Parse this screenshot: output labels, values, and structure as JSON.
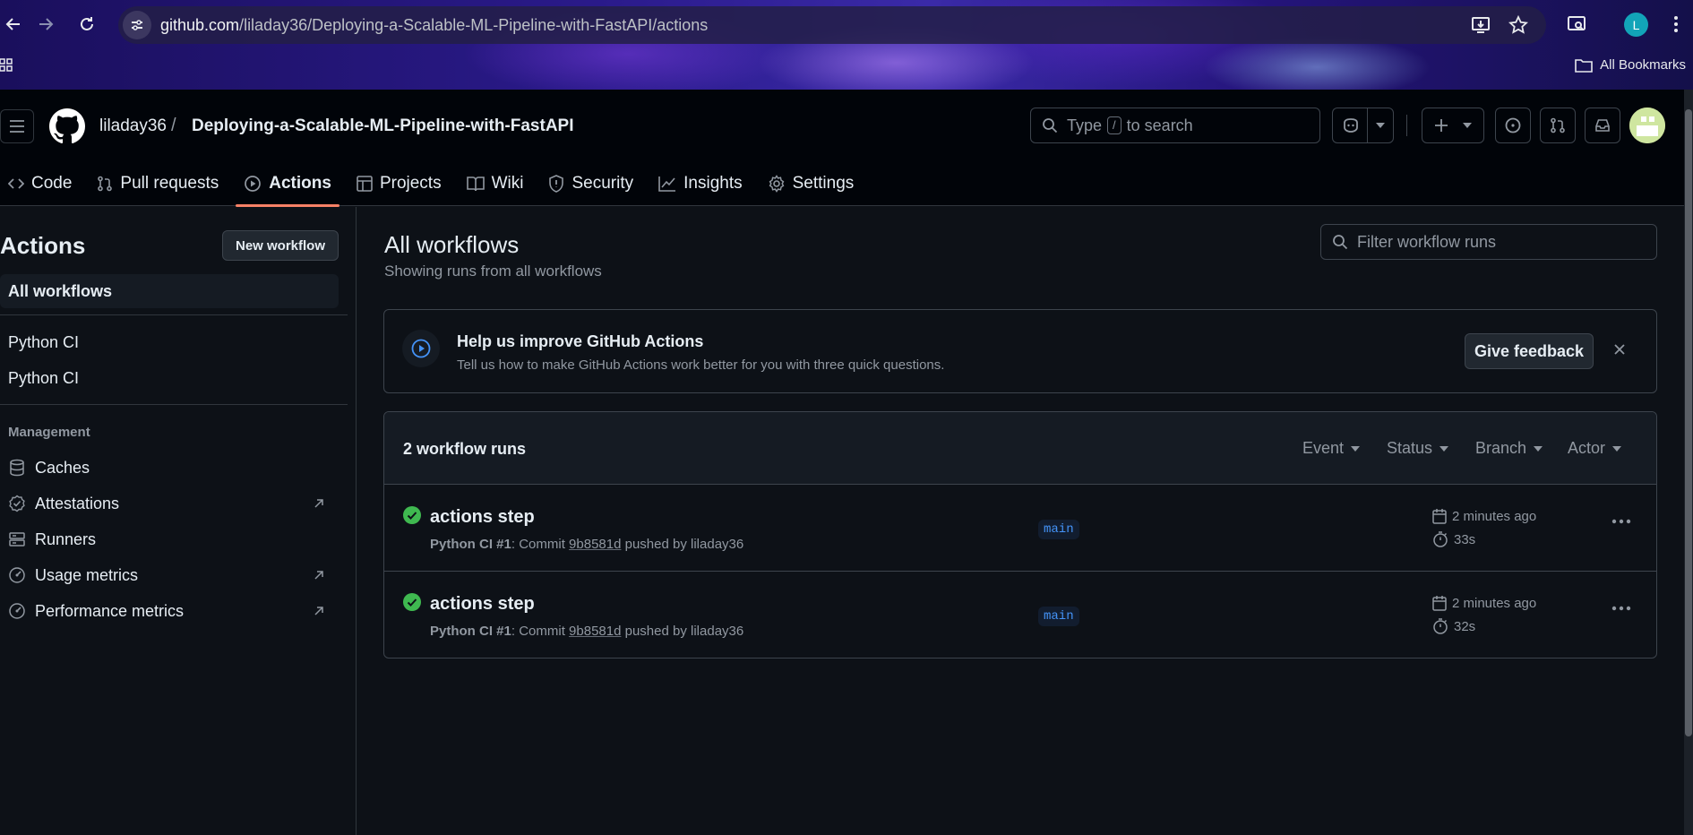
{
  "browser": {
    "url_host": "github.com",
    "url_path": "/liladay36/Deploying-a-Scalable-ML-Pipeline-with-FastAPI/actions",
    "profile_initial": "L",
    "bookmarks_label": "All Bookmarks"
  },
  "header": {
    "owner": "liladay36",
    "separator": "/",
    "repo": "Deploying-a-Scalable-ML-Pipeline-with-FastAPI",
    "search_prefix": "Type",
    "search_key": "/",
    "search_suffix": "to search"
  },
  "repo_tabs": [
    {
      "label": "Code",
      "icon": "code-icon"
    },
    {
      "label": "Pull requests",
      "icon": "pull-request-icon"
    },
    {
      "label": "Actions",
      "icon": "play-icon",
      "active": true
    },
    {
      "label": "Projects",
      "icon": "table-icon"
    },
    {
      "label": "Wiki",
      "icon": "book-icon"
    },
    {
      "label": "Security",
      "icon": "shield-icon"
    },
    {
      "label": "Insights",
      "icon": "graph-icon"
    },
    {
      "label": "Settings",
      "icon": "gear-icon"
    }
  ],
  "sidebar": {
    "title": "Actions",
    "new_workflow": "New workflow",
    "all_workflows": "All workflows",
    "workflows": [
      "Python CI",
      "Python CI"
    ],
    "management_heading": "Management",
    "management": [
      {
        "label": "Caches",
        "icon": "database-icon"
      },
      {
        "label": "Attestations",
        "icon": "verified-icon",
        "external": true
      },
      {
        "label": "Runners",
        "icon": "server-icon"
      },
      {
        "label": "Usage metrics",
        "icon": "meter-icon",
        "external": true
      },
      {
        "label": "Performance metrics",
        "icon": "meter-icon",
        "external": true
      }
    ]
  },
  "main": {
    "title": "All workflows",
    "subtitle": "Showing runs from all workflows",
    "filter_placeholder": "Filter workflow runs",
    "banner": {
      "title": "Help us improve GitHub Actions",
      "text": "Tell us how to make GitHub Actions work better for you with three quick questions.",
      "button": "Give feedback"
    },
    "runs_count": "2 workflow runs",
    "filters": [
      "Event",
      "Status",
      "Branch",
      "Actor"
    ],
    "runs": [
      {
        "title": "actions step",
        "workflow": "Python CI",
        "run_number": "#1",
        "commit_label": "Commit",
        "sha": "9b8581d",
        "pushed_by": "pushed by liladay36",
        "branch": "main",
        "time": "2 minutes ago",
        "duration": "33s",
        "status": "success"
      },
      {
        "title": "actions step",
        "workflow": "Python CI",
        "run_number": "#1",
        "commit_label": "Commit",
        "sha": "9b8581d",
        "pushed_by": "pushed by liladay36",
        "branch": "main",
        "time": "2 minutes ago",
        "duration": "32s",
        "status": "success"
      }
    ]
  },
  "colors": {
    "accent_underline": "#f78166",
    "success": "#3fb950",
    "link": "#4493f8",
    "background": "#0d1117"
  }
}
